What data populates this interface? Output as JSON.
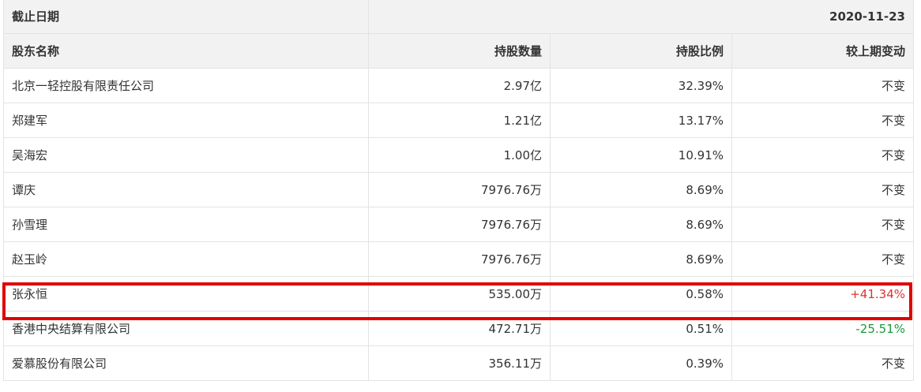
{
  "date_row": {
    "label": "截止日期",
    "value": "2020-11-23"
  },
  "headers": {
    "name": "股东名称",
    "shares": "持股数量",
    "ratio": "持股比例",
    "change": "较上期变动"
  },
  "rows": [
    {
      "name": "北京一轻控股有限责任公司",
      "shares": "2.97亿",
      "ratio": "32.39%",
      "change": "不变",
      "trend": "flat"
    },
    {
      "name": "郑建军",
      "shares": "1.21亿",
      "ratio": "13.17%",
      "change": "不变",
      "trend": "flat"
    },
    {
      "name": "吴海宏",
      "shares": "1.00亿",
      "ratio": "10.91%",
      "change": "不变",
      "trend": "flat"
    },
    {
      "name": "谭庆",
      "shares": "7976.76万",
      "ratio": "8.69%",
      "change": "不变",
      "trend": "flat"
    },
    {
      "name": "孙雪理",
      "shares": "7976.76万",
      "ratio": "8.69%",
      "change": "不变",
      "trend": "flat"
    },
    {
      "name": "赵玉岭",
      "shares": "7976.76万",
      "ratio": "8.69%",
      "change": "不变",
      "trend": "flat"
    },
    {
      "name": "张永恒",
      "shares": "535.00万",
      "ratio": "0.58%",
      "change": "+41.34%",
      "trend": "up"
    },
    {
      "name": "香港中央结算有限公司",
      "shares": "472.71万",
      "ratio": "0.51%",
      "change": "-25.51%",
      "trend": "down"
    },
    {
      "name": "爱慕股份有限公司",
      "shares": "356.11万",
      "ratio": "0.39%",
      "change": "不变",
      "trend": "flat"
    }
  ],
  "colors": {
    "up": "#e03030",
    "down": "#1a9a3a",
    "highlight": "#e00000",
    "header_bg": "#f2f2f2",
    "border": "#e3e3e3"
  },
  "highlighted_row": 6
}
